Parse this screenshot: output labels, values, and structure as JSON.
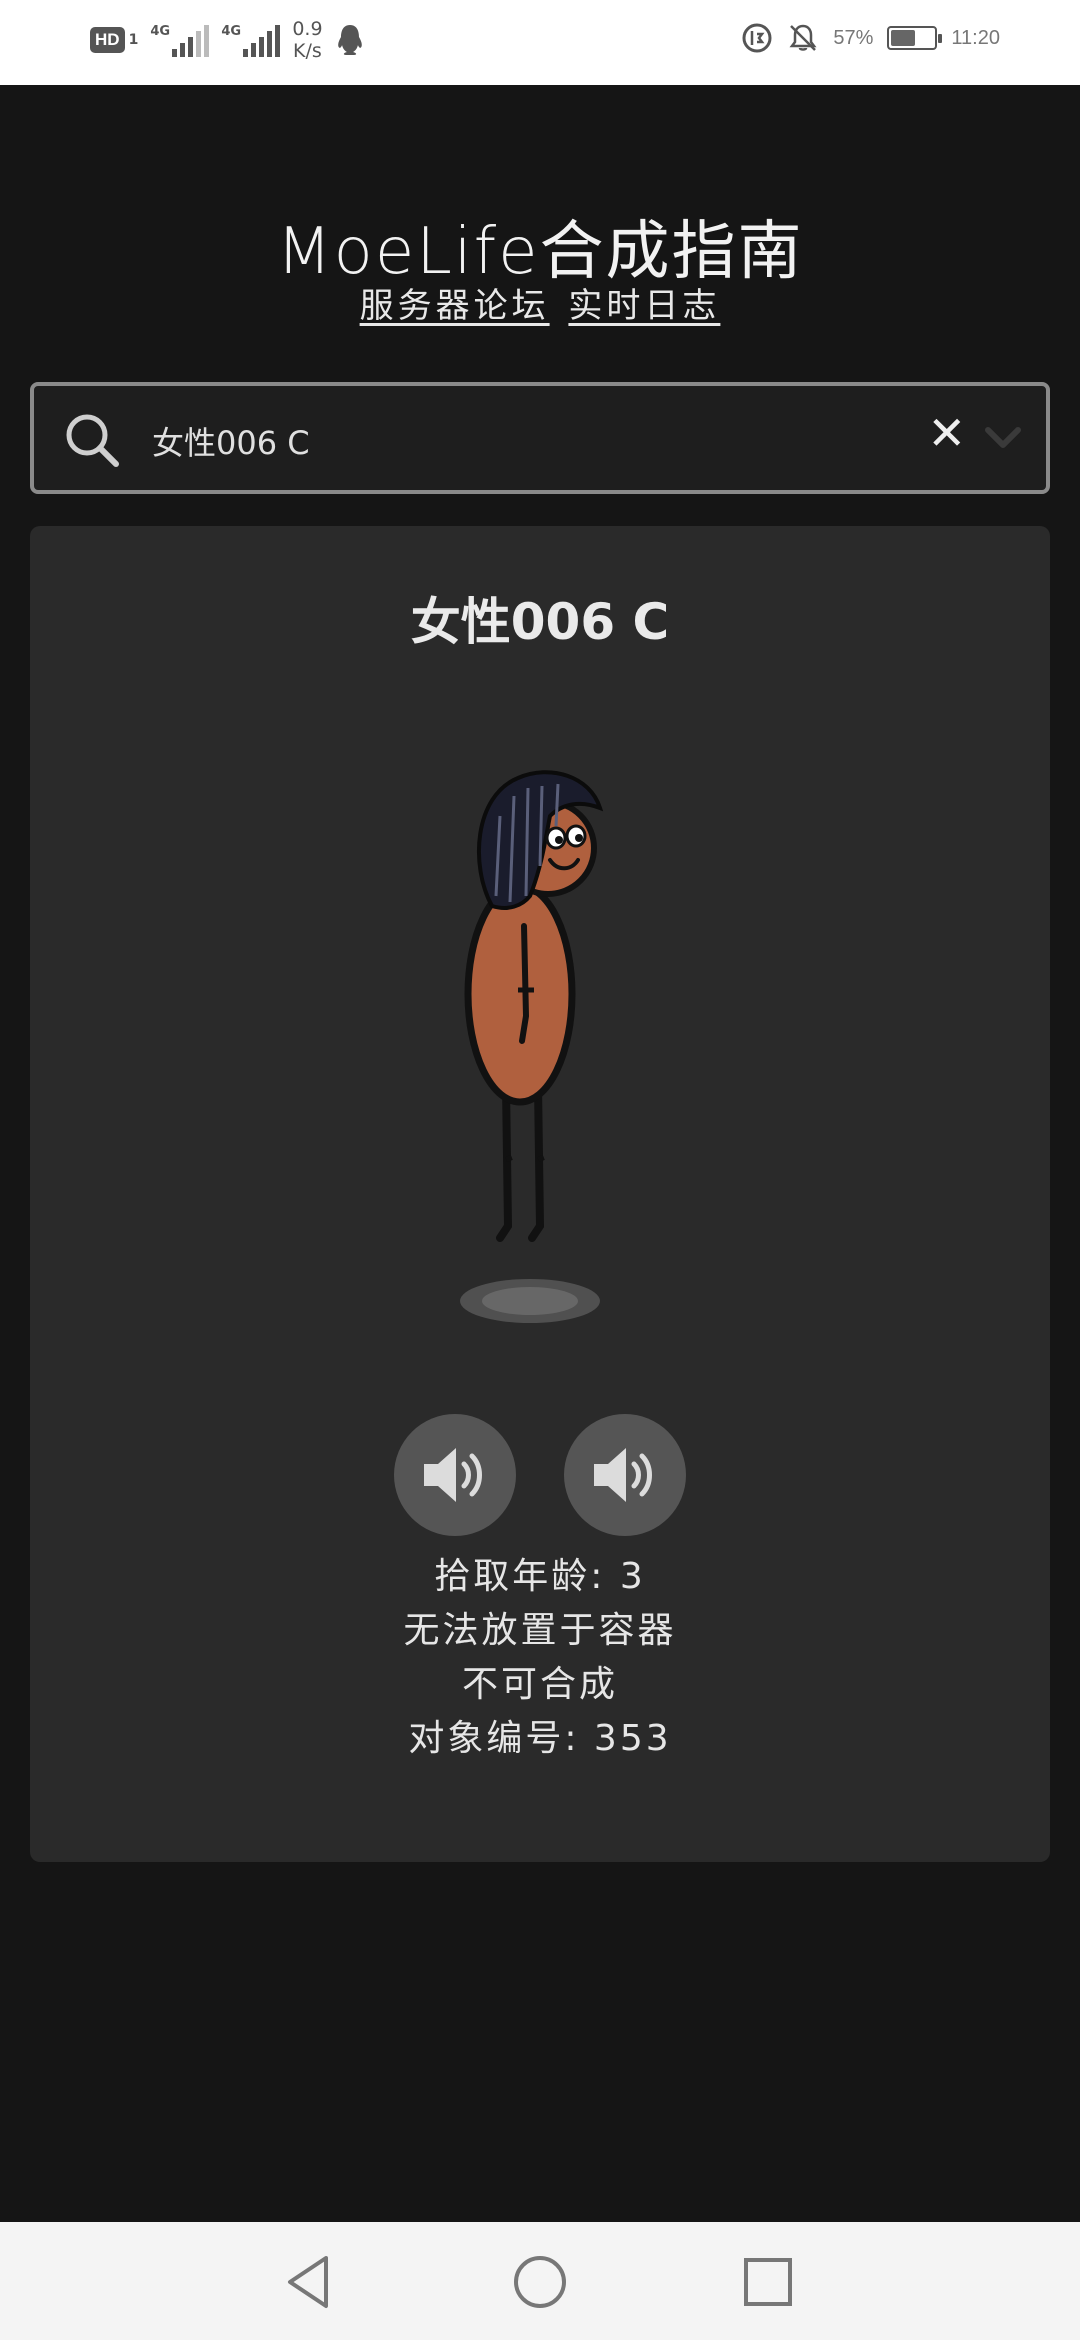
{
  "status_bar": {
    "hd_label": "HD",
    "sim_index": "1",
    "network1": "4G",
    "network2": "4G",
    "speed_value": "0.9",
    "speed_unit": "K/s",
    "battery_percent": "57%",
    "battery_level": 0.57,
    "time": "11:20"
  },
  "header": {
    "title": "MoeLife合成指南",
    "link_forum": "服务器论坛",
    "link_log": "实时日志"
  },
  "search": {
    "value": "女性006 C",
    "clear_symbol": "✕"
  },
  "item": {
    "name": "女性006 C",
    "info_lines": [
      "拾取年龄: 3",
      "无法放置于容器",
      "不可合成",
      "对象编号: 353"
    ]
  },
  "icons": {
    "search": "search-icon",
    "clear": "close-icon",
    "dropdown": "chevron-down-icon",
    "sound": "speaker-icon",
    "back": "back-triangle-icon",
    "home": "home-circle-icon",
    "recents": "recents-square-icon"
  },
  "colors": {
    "background": "#151515",
    "card": "#2a2a2a",
    "sound_button": "#555555",
    "skin": "#b0603e"
  }
}
